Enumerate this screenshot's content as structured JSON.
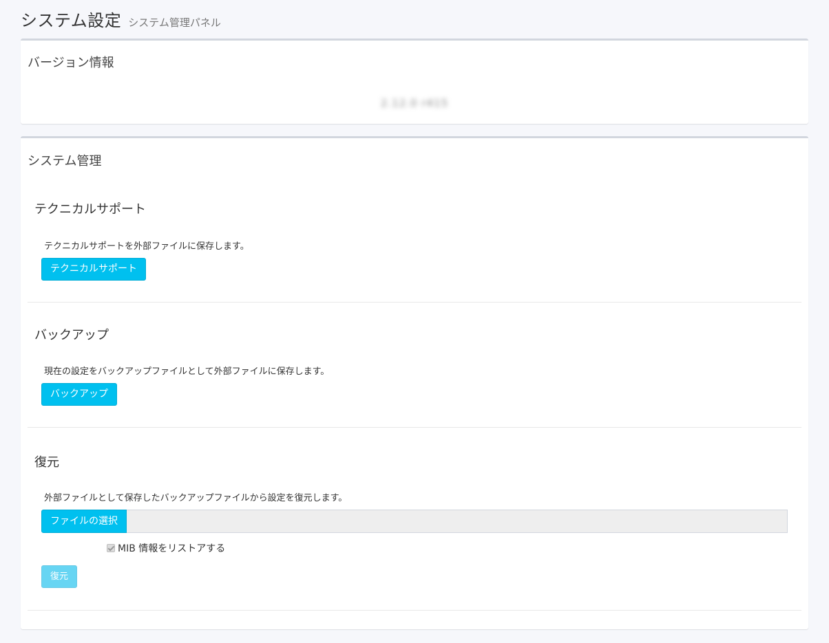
{
  "header": {
    "title": "システム設定",
    "subtitle": "システム管理パネル"
  },
  "version_card": {
    "title": "バージョン情報",
    "version": "2.12.0 r415"
  },
  "system_card": {
    "title": "システム管理",
    "support": {
      "title": "テクニカルサポート",
      "description": "テクニカルサポートを外部ファイルに保存します。",
      "button_label": "テクニカルサポート"
    },
    "backup": {
      "title": "バックアップ",
      "description": "現在の設定をバックアップファイルとして外部ファイルに保存します。",
      "button_label": "バックアップ"
    },
    "restore": {
      "title": "復元",
      "description": "外部ファイルとして保存したバックアップファイルから設定を復元します。",
      "file_button_label": "ファイルの選択",
      "file_value": "",
      "mib_checkbox_label": "MIB 情報をリストアする",
      "mib_checked": true,
      "button_label": "復元"
    }
  },
  "colors": {
    "accent": "#00c0ef",
    "background": "#f6f7fb",
    "card_border": "#d2d6de"
  }
}
